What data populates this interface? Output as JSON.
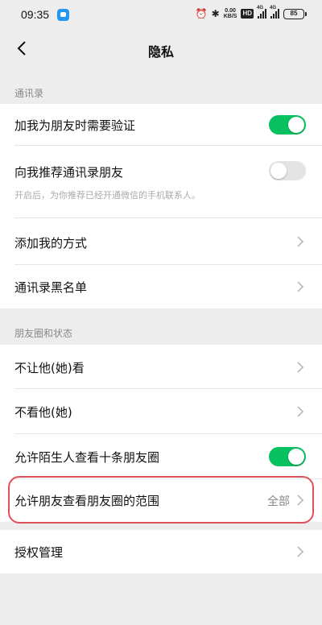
{
  "status_bar": {
    "time": "09:35",
    "speed_value": "0.00",
    "speed_unit": "KB/S",
    "hd_label": "HD",
    "signal_1_label": "4G",
    "signal_2_label": "4G",
    "battery": "85",
    "icons": [
      "app-notification-icon",
      "alarm-icon",
      "bluetooth-icon"
    ]
  },
  "nav": {
    "title": "隐私",
    "back_icon": "chevron-left-icon"
  },
  "sections": {
    "contacts": "通讯录",
    "moments": "朋友圈和状态"
  },
  "contacts": {
    "verify_label": "加我为朋友时需要验证",
    "verify_on": true,
    "recommend_label": "向我推荐通讯录朋友",
    "recommend_on": false,
    "recommend_hint": "开启后，为你推荐已经开通微信的手机联系人。",
    "add_methods_label": "添加我的方式",
    "blacklist_label": "通讯录黑名单"
  },
  "moments": {
    "hide_from_label": "不让他(她)看",
    "not_view_label": "不看他(她)",
    "strangers_ten_label": "允许陌生人查看十条朋友圈",
    "strangers_ten_on": true,
    "range_label": "允许朋友查看朋友圈的范围",
    "range_value": "全部"
  },
  "auth": {
    "label": "授权管理"
  },
  "colors": {
    "toggle_on": "#07c160",
    "toggle_off": "#e4e4e4",
    "highlight": "#e0505a",
    "background": "#ededed"
  }
}
